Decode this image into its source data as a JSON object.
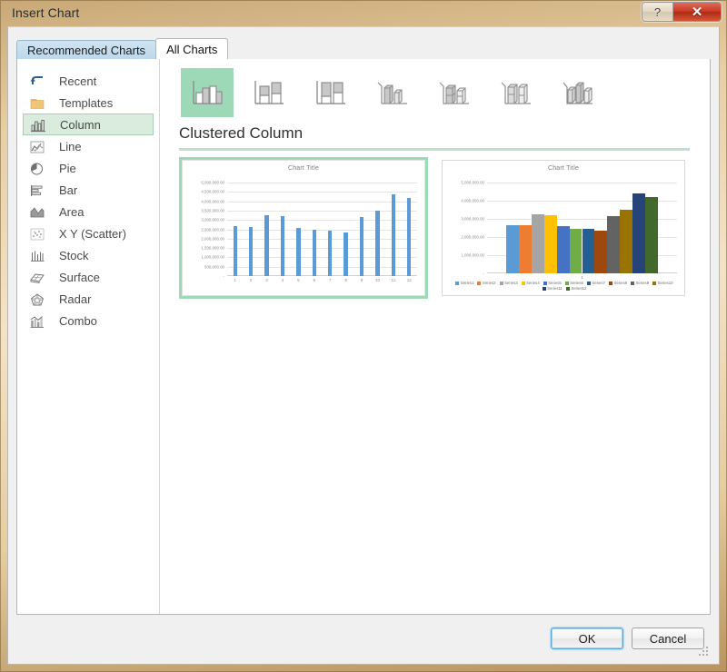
{
  "window": {
    "title": "Insert Chart",
    "help_button": "?",
    "close_button": "✕"
  },
  "tabs": [
    {
      "label": "Recommended Charts",
      "active": false,
      "name": "tab-recommended-charts"
    },
    {
      "label": "All Charts",
      "active": true,
      "name": "tab-all-charts"
    }
  ],
  "sidebar": {
    "items": [
      {
        "label": "Recent",
        "icon": "recent-icon",
        "selected": false
      },
      {
        "label": "Templates",
        "icon": "folder-icon",
        "selected": false
      },
      {
        "label": "Column",
        "icon": "column-icon",
        "selected": true
      },
      {
        "label": "Line",
        "icon": "line-icon",
        "selected": false
      },
      {
        "label": "Pie",
        "icon": "pie-icon",
        "selected": false
      },
      {
        "label": "Bar",
        "icon": "bar-icon",
        "selected": false
      },
      {
        "label": "Area",
        "icon": "area-icon",
        "selected": false
      },
      {
        "label": "X Y (Scatter)",
        "icon": "scatter-icon",
        "selected": false
      },
      {
        "label": "Stock",
        "icon": "stock-icon",
        "selected": false
      },
      {
        "label": "Surface",
        "icon": "surface-icon",
        "selected": false
      },
      {
        "label": "Radar",
        "icon": "radar-icon",
        "selected": false
      },
      {
        "label": "Combo",
        "icon": "combo-icon",
        "selected": false
      }
    ]
  },
  "subtypes": [
    {
      "name": "clustered-column",
      "selected": true
    },
    {
      "name": "stacked-column",
      "selected": false
    },
    {
      "name": "100-percent-stacked-column",
      "selected": false
    },
    {
      "name": "3d-clustered-column",
      "selected": false
    },
    {
      "name": "3d-stacked-column",
      "selected": false
    },
    {
      "name": "3d-100-percent-stacked-column",
      "selected": false
    },
    {
      "name": "3d-column",
      "selected": false
    }
  ],
  "subtype_heading": "Clustered Column",
  "footer": {
    "ok_label": "OK",
    "cancel_label": "Cancel"
  },
  "colors": {
    "accent_green": "#9ed9b7",
    "selection_green": "#d9ecdd",
    "series_bar_blue": "#5b9bd5",
    "active_tab_bg": "#ffffff",
    "inactive_tab_bg": "#c4dff0",
    "close_red": "#c93a22"
  },
  "chart_data": [
    {
      "id": "preview-clustered-column-single-series",
      "type": "bar",
      "title": "Chart Title",
      "xlabel": "",
      "ylabel": "",
      "categories": [
        "1",
        "2",
        "3",
        "4",
        "5",
        "6",
        "7",
        "8",
        "9",
        "10",
        "11",
        "12"
      ],
      "series": [
        {
          "name": "Series1",
          "color": "#5b9bd5",
          "values": [
            2670000,
            2630000,
            3270000,
            3190000,
            2590000,
            2470000,
            2440000,
            2330000,
            3150000,
            3490000,
            4380000,
            4190000
          ]
        }
      ],
      "ylim": [
        0,
        5000000
      ],
      "ytick_labels": [
        "5,000,000.00",
        "4,500,000.00",
        "4,000,000.00",
        "3,500,000.00",
        "3,000,000.00",
        "2,500,000.00",
        "2,000,000.00",
        "1,500,000.00",
        "1,000,000.00",
        "500,000.00",
        "-"
      ],
      "ytick_values": [
        5000000,
        4500000,
        4000000,
        3500000,
        3000000,
        2500000,
        2000000,
        1500000,
        1000000,
        500000,
        0
      ],
      "grid": true,
      "legend": "none"
    },
    {
      "id": "preview-clustered-column-multi-series",
      "type": "bar",
      "title": "Chart Title",
      "xlabel": "",
      "ylabel": "",
      "categories": [
        "1"
      ],
      "series": [
        {
          "name": "Series1",
          "color": "#5b9bd5",
          "values": [
            2670000
          ]
        },
        {
          "name": "Series2",
          "color": "#ed7d31",
          "values": [
            2630000
          ]
        },
        {
          "name": "Series3",
          "color": "#a5a5a5",
          "values": [
            3270000
          ]
        },
        {
          "name": "Series4",
          "color": "#ffc000",
          "values": [
            3190000
          ]
        },
        {
          "name": "Series5",
          "color": "#4472c4",
          "values": [
            2590000
          ]
        },
        {
          "name": "Series6",
          "color": "#70ad47",
          "values": [
            2470000
          ]
        },
        {
          "name": "Series7",
          "color": "#255e91",
          "values": [
            2440000
          ]
        },
        {
          "name": "Series8",
          "color": "#9e480e",
          "values": [
            2330000
          ]
        },
        {
          "name": "Series9",
          "color": "#636363",
          "values": [
            3150000
          ]
        },
        {
          "name": "Series10",
          "color": "#997300",
          "values": [
            3490000
          ]
        },
        {
          "name": "Series11",
          "color": "#264478",
          "values": [
            4380000
          ]
        },
        {
          "name": "Series12",
          "color": "#43682b",
          "values": [
            4190000
          ]
        }
      ],
      "ylim": [
        0,
        5000000
      ],
      "ytick_labels": [
        "5,000,000.00",
        "4,000,000.00",
        "3,000,000.00",
        "2,000,000.00",
        "1,000,000.00",
        "-"
      ],
      "ytick_values": [
        5000000,
        4000000,
        3000000,
        2000000,
        1000000,
        0
      ],
      "grid": true,
      "legend": "bottom"
    }
  ]
}
